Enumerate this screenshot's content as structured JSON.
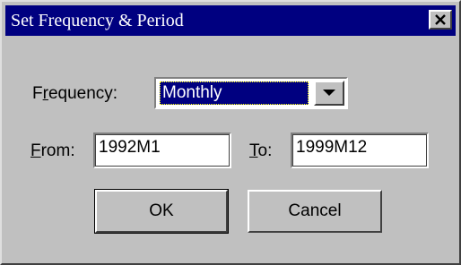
{
  "dialog": {
    "title": "Set Frequency & Period",
    "close_symbol": "×"
  },
  "frequency": {
    "label_accel": "r",
    "label_pre": "F",
    "label_post": "equency:",
    "selected": "Monthly"
  },
  "from": {
    "label_accel": "F",
    "label_post": "rom:",
    "value": "1992M1"
  },
  "to": {
    "label_accel": "T",
    "label_post": "o:",
    "value": "1999M12"
  },
  "buttons": {
    "ok_label": "OK",
    "cancel_label": "Cancel"
  },
  "icons": {
    "close": "close-icon",
    "dropdown": "chevron-down-icon"
  }
}
